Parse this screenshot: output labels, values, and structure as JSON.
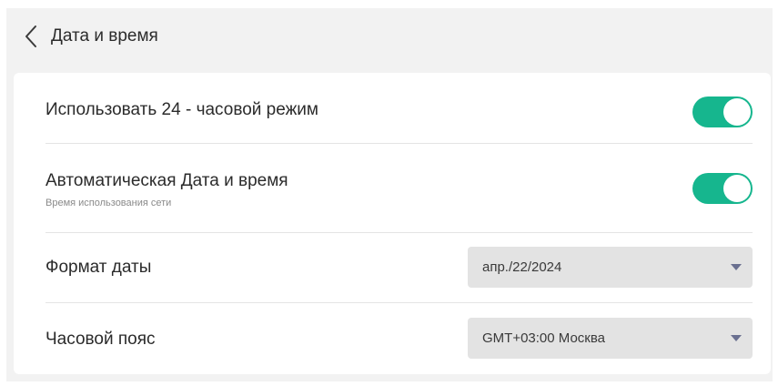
{
  "header": {
    "title": "Дата и время",
    "back_icon": "chevron-left-icon"
  },
  "settings": {
    "use_24h": {
      "label": "Использовать 24 - часовой режим",
      "enabled": true
    },
    "auto_datetime": {
      "label": "Автоматическая Дата и время",
      "sublabel": "Время использования сети",
      "enabled": true
    },
    "date_format": {
      "label": "Формат даты",
      "value": "апр./22/2024"
    },
    "timezone": {
      "label": "Часовой пояс",
      "value": "GMT+03:00 Москва"
    }
  },
  "colors": {
    "accent": "#16b68e",
    "dropdown_arrow": "#6a7090",
    "background": "#f2f2f2",
    "card": "#ffffff"
  }
}
